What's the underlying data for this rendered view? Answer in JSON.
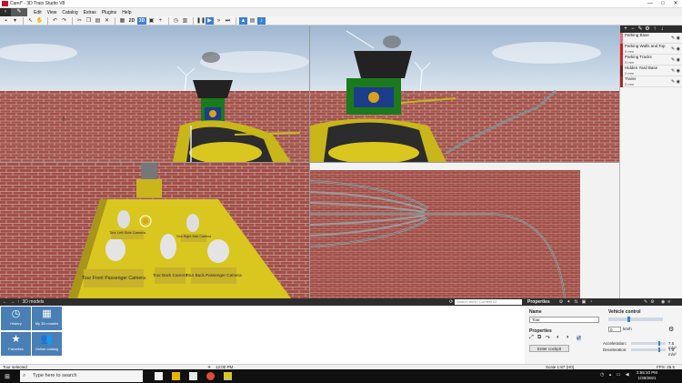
{
  "window": {
    "title": "Carel* - 3D Train Studio V8",
    "controls": [
      "—",
      "□",
      "✕"
    ]
  },
  "menu": {
    "back_label": "‹",
    "edit_label": "✎",
    "items": [
      "Edit",
      "View",
      "Catalog",
      "Extras",
      "Plugins",
      "Help"
    ]
  },
  "toolbar": {
    "view_2d_label": "2D",
    "view_3d_label": "3D"
  },
  "layers": {
    "items": [
      {
        "name": "Parking Base",
        "sub": "-",
        "color": "#e86c7a"
      },
      {
        "name": "Parking Walls and Top",
        "sub": "0 mm",
        "color": "#d81b1b"
      },
      {
        "name": "Parking Tracks",
        "sub": "0 mm",
        "color": "#c62828"
      },
      {
        "name": "Hidden Yard Base",
        "sub": "0 mm",
        "color": "#7b1f1f"
      },
      {
        "name": "Trains",
        "sub": "0 mm",
        "color": "#a52a2a"
      }
    ]
  },
  "scene": {
    "camera_labels": {
      "left_side": "Tour Left Side Camera",
      "right_side": "Tour Right Side Camera",
      "front_passenger": "Tour Front Passenger Camera",
      "back": "Tour Back Camera",
      "back_passenger": "Tour Back Passenger Camera"
    }
  },
  "catalog": {
    "title": "3D models",
    "search_placeholder": "Search term / Content ID",
    "tiles": [
      {
        "label": "History",
        "icon": "clock-icon"
      },
      {
        "label": "My 3D models",
        "icon": "grid-icon"
      },
      {
        "label": "Favorites",
        "icon": "star-icon"
      },
      {
        "label": "Online catalog",
        "icon": "people-icon"
      }
    ]
  },
  "properties": {
    "header": "Properties",
    "name_label": "Name",
    "name_value": "Tour",
    "vehicle_control_label": "Vehicle control",
    "speed_value": "0",
    "speed_unit": "km/h",
    "properties_label": "Properties",
    "cockpit_button": "Enter cockpit",
    "acceleration_label": "Acceleration:",
    "acceleration_value": "7.5 m/s²",
    "deceleration_label": "Deceleration:",
    "deceleration_value": "7.5 m/s²"
  },
  "status": {
    "left": "Tour selected",
    "time": "12:00 PM",
    "scale": "Scale 1:87 (H0)",
    "fps": "FPS: 26.5"
  },
  "taskbar": {
    "search_placeholder": "Type here to search",
    "time": "2:55:10 PM",
    "date": "1/30/2021"
  },
  "colors": {
    "brick": "#a24f48",
    "sky": "#b8cce0",
    "accent": "#3b7fd8",
    "panel_dark": "#2d2d2d"
  }
}
